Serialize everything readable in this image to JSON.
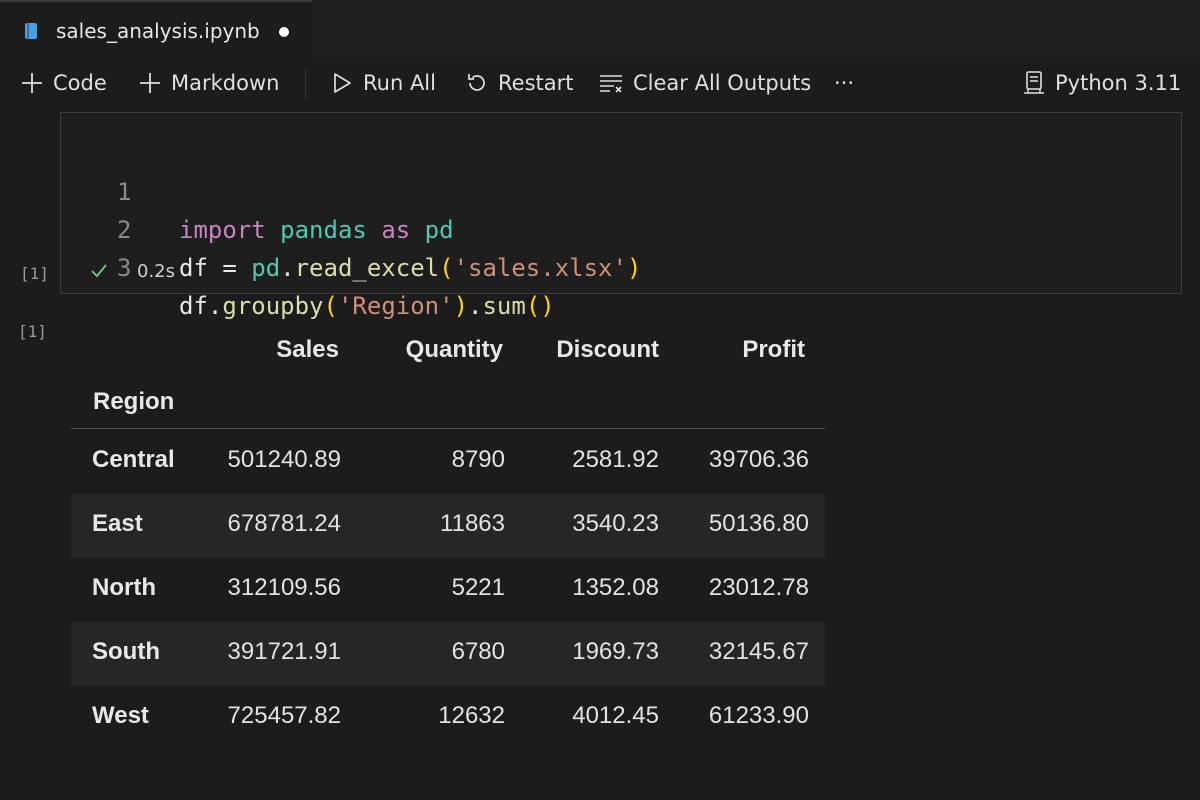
{
  "tab": {
    "title": "sales_analysis.ipynb",
    "icon": "notebook-icon",
    "unsaved": true
  },
  "toolbar": {
    "code_label": "Code",
    "markdown_label": "Markdown",
    "run_all_label": "Run All",
    "restart_label": "Restart",
    "clear_outputs_label": "Clear All Outputs",
    "more_label": "···",
    "kernel_label": "Python 3.11"
  },
  "cell": {
    "execution_count": "[1]",
    "status_time": "0.2s",
    "status": "success",
    "lines": [
      {
        "number": "1",
        "text": "import pandas as pd"
      },
      {
        "number": "2",
        "text": "df = pd.read_excel('sales.xlsx')"
      },
      {
        "number": "3",
        "text": "df.groupby('Region').sum()"
      }
    ]
  },
  "output": {
    "execution_count": "[1]",
    "index_name": "Region",
    "columns": [
      "Sales",
      "Quantity",
      "Discount",
      "Profit"
    ],
    "rows": [
      {
        "index": "Central",
        "values": [
          "501240.89",
          "8790",
          "2581.92",
          "39706.36"
        ]
      },
      {
        "index": "East",
        "values": [
          "678781.24",
          "11863",
          "3540.23",
          "50136.80"
        ]
      },
      {
        "index": "North",
        "values": [
          "312109.56",
          "5221",
          "1352.08",
          "23012.78"
        ]
      },
      {
        "index": "South",
        "values": [
          "391721.91",
          "6780",
          "1969.73",
          "32145.67"
        ]
      },
      {
        "index": "West",
        "values": [
          "725457.82",
          "12632",
          "4012.45",
          "61233.90"
        ]
      }
    ]
  },
  "colors": {
    "keyword": "#c586c0",
    "module": "#4ec9b0",
    "string": "#ce9178",
    "function": "#dcdcaa",
    "bracket": "#ffd700",
    "success": "#73c991"
  }
}
